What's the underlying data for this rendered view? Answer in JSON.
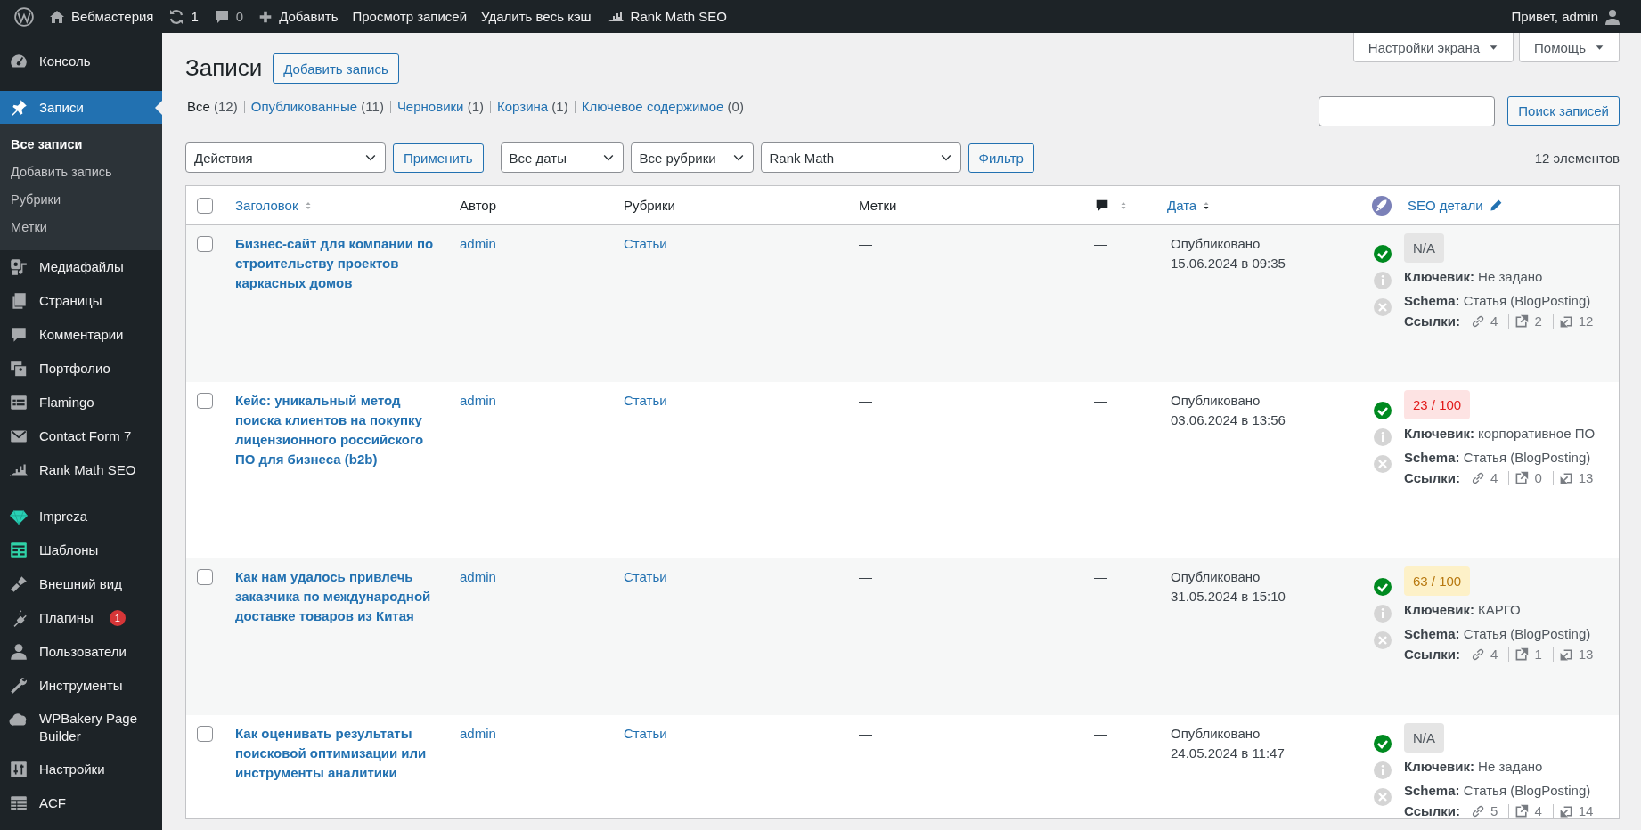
{
  "admin_bar": {
    "site_name": "Вебмастерия",
    "updates": "1",
    "comments": "0",
    "new_label": "Добавить",
    "links": [
      "Просмотр записей",
      "Удалить весь кэш"
    ],
    "plugin_link": "Rank Math SEO",
    "greeting": "Привет, admin"
  },
  "sidebar": {
    "groups": [
      {
        "items": [
          {
            "label": "Консоль",
            "selected": false
          }
        ]
      },
      {
        "items": [
          {
            "label": "Записи",
            "selected": true,
            "children": [
              {
                "label": "Все записи",
                "selected": true
              },
              {
                "label": "Добавить запись",
                "selected": false
              },
              {
                "label": "Рубрики",
                "selected": false
              },
              {
                "label": "Метки",
                "selected": false
              }
            ]
          },
          {
            "label": "Медиафайлы",
            "selected": false
          },
          {
            "label": "Страницы",
            "selected": false
          },
          {
            "label": "Комментарии",
            "selected": false
          },
          {
            "label": "Портфолио",
            "selected": false
          },
          {
            "label": "Flamingo",
            "selected": false
          },
          {
            "label": "Contact Form 7",
            "selected": false
          },
          {
            "label": "Rank Math SEO",
            "selected": false
          }
        ]
      },
      {
        "items": [
          {
            "label": "Impreza",
            "selected": false
          },
          {
            "label": "Шаблоны",
            "selected": false
          },
          {
            "label": "Внешний вид",
            "selected": false
          },
          {
            "label": "Плагины",
            "selected": false,
            "badge": "1"
          },
          {
            "label": "Пользователи",
            "selected": false
          },
          {
            "label": "Инструменты",
            "selected": false
          },
          {
            "label": "WPBakery Page Builder",
            "selected": false
          },
          {
            "label": "Настройки",
            "selected": false
          },
          {
            "label": "ACF",
            "selected": false
          }
        ]
      }
    ]
  },
  "screen_meta": [
    "Настройки экрана",
    "Помощь"
  ],
  "page": {
    "title": "Записи",
    "add_button": "Добавить запись"
  },
  "views": [
    {
      "label": "Все",
      "count": "(12)",
      "selected": true
    },
    {
      "label": "Опубликованные",
      "count": "(11)",
      "selected": false
    },
    {
      "label": "Черновики",
      "count": "(1)",
      "selected": false
    },
    {
      "label": "Корзина",
      "count": "(1)",
      "selected": false
    },
    {
      "label": "Ключевое содержимое",
      "count": "(0)",
      "selected": false
    }
  ],
  "search": {
    "button": "Поиск записей"
  },
  "filters": {
    "bulk_action": "Действия",
    "apply": "Применить",
    "selects": [
      "Все даты",
      "Все рубрики",
      "Rank Math"
    ],
    "filter_button": "Фильтр",
    "count": "12 элементов"
  },
  "table": {
    "select_all_checked": false,
    "columns": [
      {
        "label": "Заголовок",
        "kind": "sortable",
        "sorted": false
      },
      {
        "label": "Автор",
        "kind": "plain"
      },
      {
        "label": "Рубрики",
        "kind": "plain"
      },
      {
        "label": "Метки",
        "kind": "plain"
      },
      {
        "kind": "comments",
        "sorted": false
      },
      {
        "label": "Дата",
        "kind": "sortable",
        "sorted": true
      },
      {
        "kind": "seo-score"
      },
      {
        "label": "SEO детали",
        "kind": "editable"
      }
    ],
    "rows": [
      {
        "checked": false,
        "title": "Бизнес-сайт для компании по строительству проектов каркасных домов",
        "author": "admin",
        "category": "Статьи",
        "tags": "—",
        "comments": "—",
        "status": "Опубликовано",
        "date": "15.06.2024 в 09:35",
        "score": {
          "text": "N/A",
          "kind": "na"
        },
        "keyword": "**Ключевик:** Не задано",
        "schema": "**Schema:** Статья (BlogPosting)",
        "links_label": "Ссылки:",
        "links": [
          {
            "kind": "internal",
            "count": "4"
          },
          {
            "kind": "external",
            "count": "2"
          },
          {
            "kind": "incoming",
            "count": "12"
          }
        ]
      },
      {
        "checked": false,
        "title": "Кейс: уникальный метод поиска клиентов на покупку лицензионного российского ПО для бизнеса (b2b)",
        "author": "admin",
        "category": "Статьи",
        "tags": "—",
        "comments": "—",
        "status": "Опубликовано",
        "date": "03.06.2024 в 13:56",
        "score": {
          "text": "23 / 100",
          "kind": "bad"
        },
        "keyword": "**Ключевик:** корпоративное ПО",
        "schema": "**Schema:** Статья (BlogPosting)",
        "links_label": "Ссылки:",
        "links": [
          {
            "kind": "internal",
            "count": "4"
          },
          {
            "kind": "external",
            "count": "0"
          },
          {
            "kind": "incoming",
            "count": "13"
          }
        ]
      },
      {
        "checked": false,
        "title": "Как нам удалось привлечь заказчика по международной доставке товаров из Китая",
        "author": "admin",
        "category": "Статьи",
        "tags": "—",
        "comments": "—",
        "status": "Опубликовано",
        "date": "31.05.2024 в 15:10",
        "score": {
          "text": "63 / 100",
          "kind": "ok"
        },
        "keyword": "**Ключевик:** КАРГО",
        "schema": "**Schema:** Статья (BlogPosting)",
        "links_label": "Ссылки:",
        "links": [
          {
            "kind": "internal",
            "count": "4"
          },
          {
            "kind": "external",
            "count": "1"
          },
          {
            "kind": "incoming",
            "count": "13"
          }
        ]
      },
      {
        "checked": false,
        "title": "Как оценивать результаты поисковой оптимизации или инструменты аналитики",
        "author": "admin",
        "category": "Статьи",
        "tags": "—",
        "comments": "—",
        "status": "Опубликовано",
        "date": "24.05.2024 в 11:47",
        "score": {
          "text": "N/A",
          "kind": "na"
        },
        "keyword": "**Ключевик:** Не задано",
        "schema": "**Schema:** Статья (BlogPosting)",
        "links_label": "Ссылки:",
        "links": [
          {
            "kind": "internal",
            "count": "5"
          },
          {
            "kind": "external",
            "count": "4"
          },
          {
            "kind": "incoming",
            "count": "14"
          }
        ]
      }
    ]
  }
}
